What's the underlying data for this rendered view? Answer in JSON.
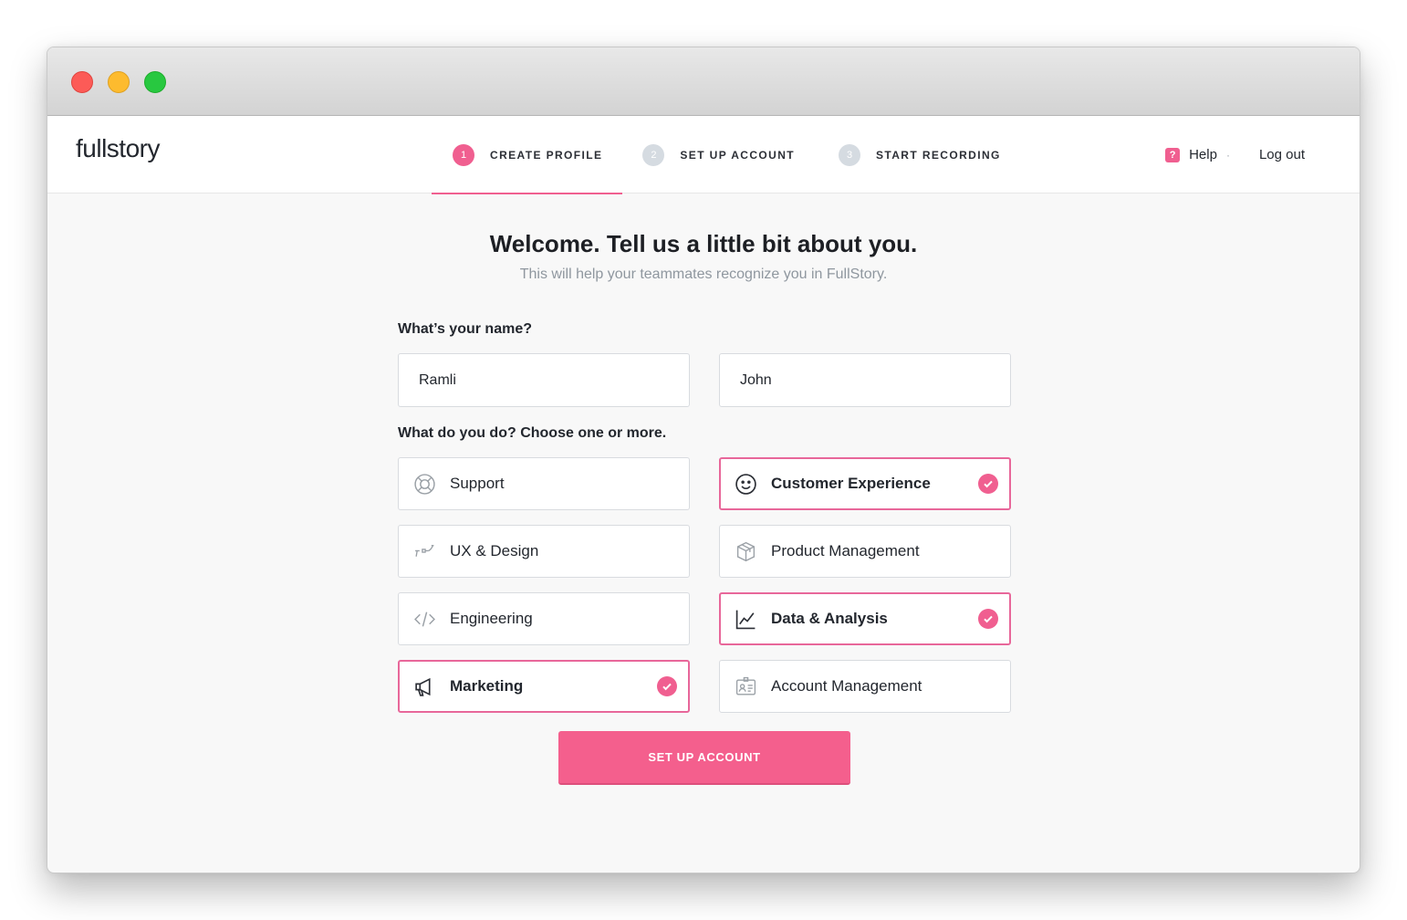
{
  "window": {
    "buttons": [
      "close",
      "minimize",
      "zoom"
    ]
  },
  "header": {
    "logo": "fullstory",
    "steps": [
      {
        "number": "1",
        "label": "CREATE PROFILE",
        "active": true
      },
      {
        "number": "2",
        "label": "SET UP ACCOUNT",
        "active": false
      },
      {
        "number": "3",
        "label": "START RECORDING",
        "active": false
      }
    ],
    "help_icon": "?",
    "help_label": "Help",
    "separator": "·",
    "logout_label": "Log out"
  },
  "main": {
    "title": "Welcome. Tell us a little bit about you.",
    "subtitle": "This will help your teammates recognize you in FullStory.",
    "name_question": "What’s your name?",
    "first_name_value": "Ramli",
    "last_name_value": "John",
    "role_question": "What do you do? Choose one or more.",
    "roles": [
      {
        "label": "Support",
        "icon": "lifebuoy-icon",
        "selected": false
      },
      {
        "label": "Customer Experience",
        "icon": "smiley-icon",
        "selected": true
      },
      {
        "label": "UX & Design",
        "icon": "vector-path-icon",
        "selected": false
      },
      {
        "label": "Product Management",
        "icon": "package-icon",
        "selected": false
      },
      {
        "label": "Engineering",
        "icon": "code-icon",
        "selected": false
      },
      {
        "label": "Data & Analysis",
        "icon": "line-chart-icon",
        "selected": true
      },
      {
        "label": "Marketing",
        "icon": "megaphone-icon",
        "selected": true
      },
      {
        "label": "Account Management",
        "icon": "id-card-icon",
        "selected": false
      }
    ],
    "submit_label": "SET UP ACCOUNT"
  },
  "colors": {
    "accent": "#f05f90",
    "border": "#d8dbdf",
    "text": "#23272e",
    "muted": "#8f979f"
  }
}
